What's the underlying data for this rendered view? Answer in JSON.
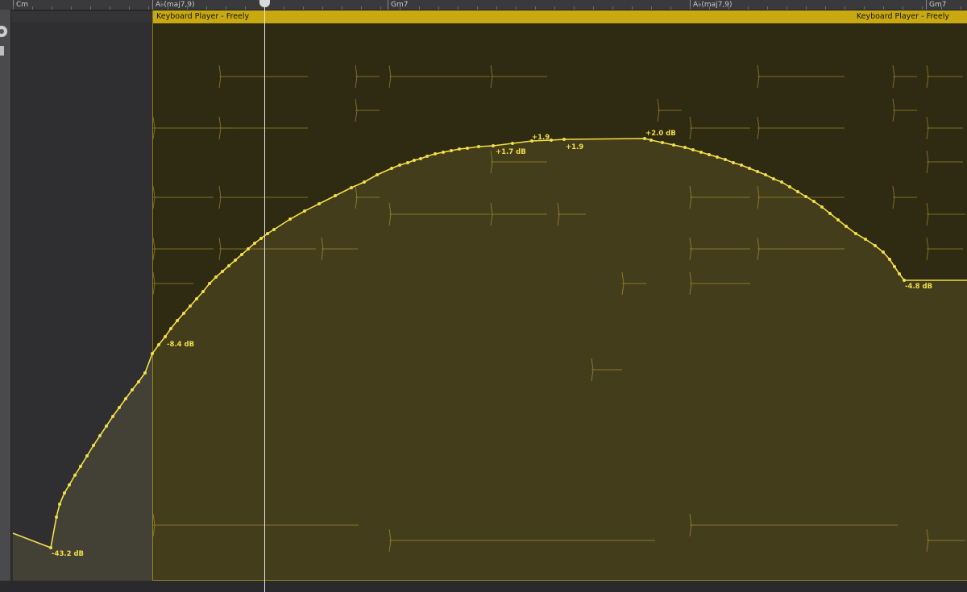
{
  "ruler": {
    "chords": [
      {
        "label": "Cm"
      },
      {
        "label": "A♭(maj7,9)"
      },
      {
        "label": "Gm7"
      },
      {
        "label": "A♭(maj7,9)"
      },
      {
        "label": "Gm7"
      }
    ]
  },
  "region": {
    "title_left": "Keyboard Player - Freely",
    "title_right": "Keyboard Player - Freely",
    "color": "#c9a912"
  },
  "automation": {
    "line_color": "#f2df49",
    "labels": {
      "start": "-43.2 dB",
      "entry": "-8.4 dB",
      "peak_a": "+1.7 dB",
      "peak_b": "+1.9",
      "peak_c": "+1.9",
      "peak_d": "+2.0 dB",
      "end": "-4.8 dB"
    }
  }
}
